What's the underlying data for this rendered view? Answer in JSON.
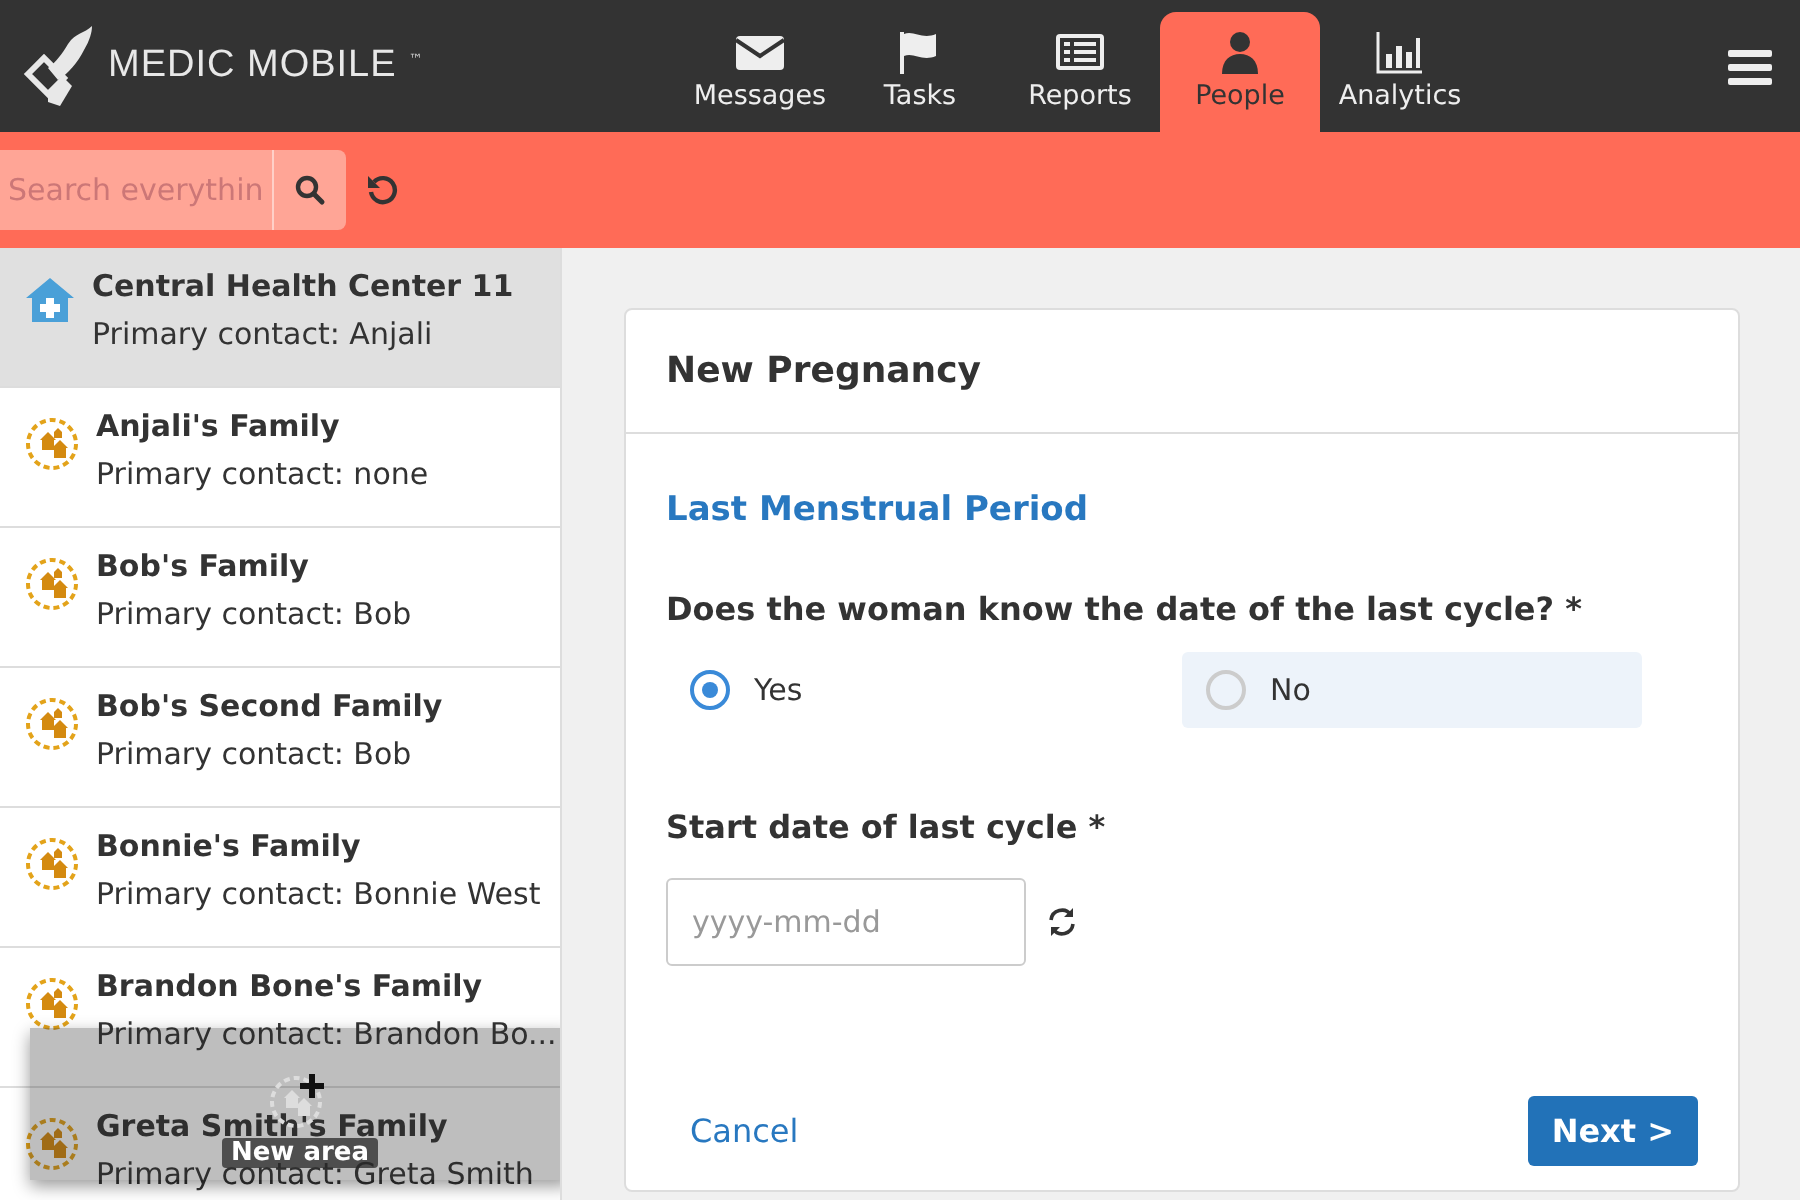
{
  "header": {
    "logo_text": "MEDIC MOBILE",
    "trademark": "™",
    "tabs": [
      {
        "label": "Messages",
        "selected": false
      },
      {
        "label": "Tasks",
        "selected": false
      },
      {
        "label": "Reports",
        "selected": false
      },
      {
        "label": "People",
        "selected": true
      },
      {
        "label": "Analytics",
        "selected": false
      }
    ]
  },
  "search": {
    "placeholder": "Search everythin"
  },
  "contacts": [
    {
      "kind": "facility",
      "name": "Central Health Center 11",
      "subtitle": "Primary contact: Anjali",
      "selected": true
    },
    {
      "kind": "family",
      "name": "Anjali's Family",
      "subtitle": "Primary contact: none",
      "selected": false
    },
    {
      "kind": "family",
      "name": "Bob's Family",
      "subtitle": "Primary contact: Bob",
      "selected": false
    },
    {
      "kind": "family",
      "name": "Bob's Second Family",
      "subtitle": "Primary contact: Bob",
      "selected": false
    },
    {
      "kind": "family",
      "name": "Bonnie's Family",
      "subtitle": "Primary contact: Bonnie West",
      "selected": false
    },
    {
      "kind": "family",
      "name": "Brandon Bone's Family",
      "subtitle": "Primary contact: Brandon Bo...",
      "selected": false
    },
    {
      "kind": "family",
      "name": "Greta Smith's Family",
      "subtitle": "Primary contact: Greta Smith",
      "selected": false
    }
  ],
  "drag_toast": {
    "label": "New area"
  },
  "form": {
    "title": "New Pregnancy",
    "section": "Last Menstrual Period",
    "question": "Does the woman know the date of the last cycle? *",
    "options": [
      {
        "label": "Yes",
        "selected": true,
        "highlighted": false
      },
      {
        "label": "No",
        "selected": false,
        "highlighted": true
      }
    ],
    "date_label": "Start date of last cycle *",
    "date_placeholder": "yyyy-mm-dd",
    "cancel": "Cancel",
    "next": "Next >"
  }
}
